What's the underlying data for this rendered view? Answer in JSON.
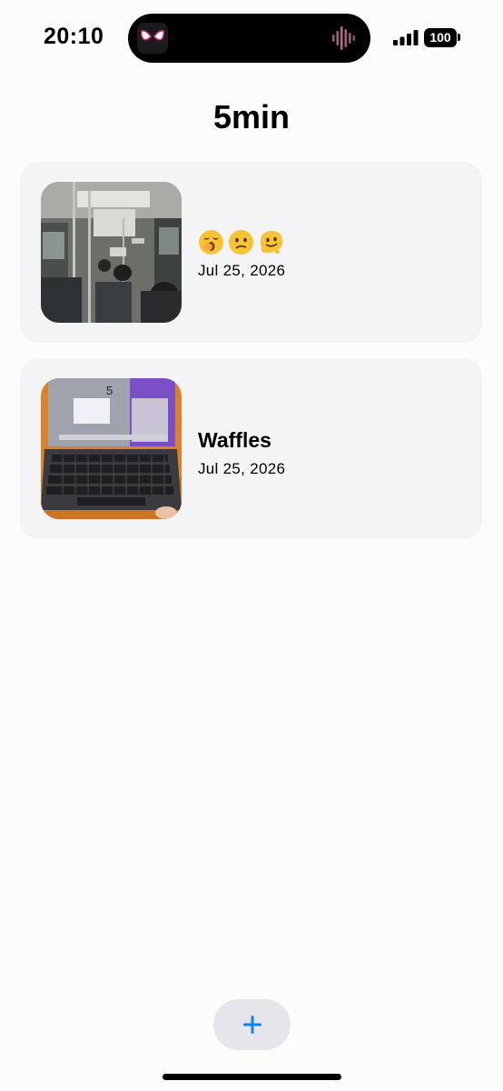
{
  "status_bar": {
    "time": "20:10",
    "battery": "100",
    "signal_icon": "cellular-signal-icon",
    "island_app_icon": "spider-mask-icon",
    "island_activity_icon": "audio-waveform-icon"
  },
  "page": {
    "title": "5min"
  },
  "entries": [
    {
      "image_icon": "bus-interior-photo",
      "emojis": [
        "🥱",
        "😕",
        "🫠"
      ],
      "title": "",
      "date": "Jul 25, 2026"
    },
    {
      "image_icon": "laptop-photo",
      "title": "Waffles",
      "date": "Jul 25, 2026"
    }
  ],
  "add_button": {
    "icon": "plus-icon",
    "color": "#0a84ff"
  },
  "colors": {
    "background": "#fcfcfd",
    "card": "#f4f4f6",
    "accent": "#0a84ff"
  }
}
